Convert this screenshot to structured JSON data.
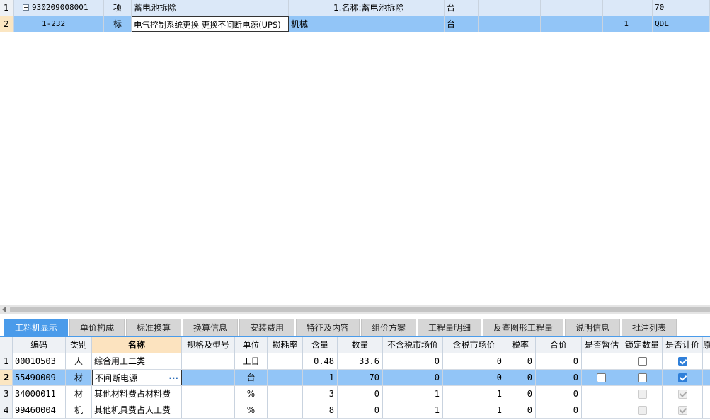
{
  "top_grid": {
    "rows": [
      {
        "num": "1",
        "code": "930209008001",
        "type": "项",
        "name": "蓄电池拆除",
        "category": "",
        "feature": "1.名称:蓄电池拆除",
        "unit": "台",
        "qty": "",
        "extra": "70"
      },
      {
        "num": "2",
        "code": "1-232",
        "type": "标",
        "name": "电气控制系统更换 更换不间断电源(UPS)",
        "category": "机械",
        "feature": "",
        "unit": "台",
        "qty": "1",
        "extra": "QDL"
      }
    ]
  },
  "tabs": [
    "工料机显示",
    "单价构成",
    "标准换算",
    "换算信息",
    "安装费用",
    "特征及内容",
    "组价方案",
    "工程量明细",
    "反查图形工程量",
    "说明信息",
    "批注列表"
  ],
  "active_tab": "工料机显示",
  "bottom_grid": {
    "headers": [
      "编码",
      "类别",
      "名称",
      "规格及型号",
      "单位",
      "损耗率",
      "含量",
      "数量",
      "不含税市场价",
      "含税市场价",
      "税率",
      "合价",
      "是否暂估",
      "锁定数量",
      "是否计价",
      "原"
    ],
    "rows": [
      {
        "num": "1",
        "code": "00010503",
        "cat": "人",
        "name": "综合用工二类",
        "spec": "",
        "unit": "工日",
        "loss": "",
        "content": "0.48",
        "qty": "33.6",
        "price_ex": "0",
        "price_in": "0",
        "tax": "0",
        "total": "0",
        "estimate": null,
        "lock": false,
        "priced": true,
        "disabled": false
      },
      {
        "num": "2",
        "code": "55490009",
        "cat": "材",
        "name": "不间断电源",
        "spec": "",
        "unit": "台",
        "loss": "",
        "content": "1",
        "qty": "70",
        "price_ex": "0",
        "price_in": "0",
        "tax": "0",
        "total": "0",
        "estimate": false,
        "lock": false,
        "priced": true,
        "disabled": false
      },
      {
        "num": "3",
        "code": "34000011",
        "cat": "材",
        "name": "其他材料费占材料费",
        "spec": "",
        "unit": "%",
        "loss": "",
        "content": "3",
        "qty": "0",
        "price_ex": "1",
        "price_in": "1",
        "tax": "0",
        "total": "0",
        "estimate": null,
        "lock": false,
        "priced": true,
        "disabled": true
      },
      {
        "num": "4",
        "code": "99460004",
        "cat": "机",
        "name": "其他机具费占人工费",
        "spec": "",
        "unit": "%",
        "loss": "",
        "content": "8",
        "qty": "0",
        "price_ex": "1",
        "price_in": "1",
        "tax": "0",
        "total": "0",
        "estimate": null,
        "lock": false,
        "priced": true,
        "disabled": true
      }
    ],
    "ellipsis": "···"
  }
}
